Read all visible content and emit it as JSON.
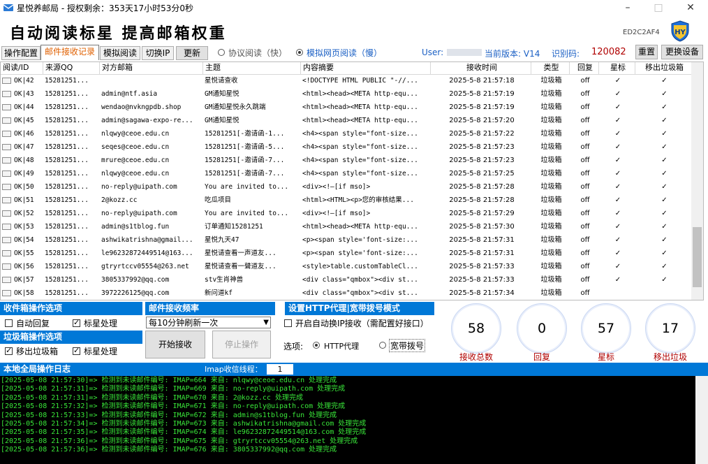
{
  "window": {
    "title": "星悦养邮局 - 授权剩余：353天17小时53分0秒",
    "min_icon": "minimize-icon",
    "max_icon": "maximize-icon",
    "close_icon": "close-icon"
  },
  "header": {
    "title": "自动阅读标星 提高邮箱权重",
    "code": "ED2C2AF4",
    "logo_icon": "app-logo-icon"
  },
  "tabs": [
    {
      "label": "操作配置"
    },
    {
      "label": "邮件接收记录"
    },
    {
      "label": "模拟阅读"
    },
    {
      "label": "切换IP"
    }
  ],
  "toolbar": {
    "update_label": "更新",
    "radio_protocol": "协议阅读（快）",
    "radio_web": "模拟网页阅读（慢）",
    "user_label": "User:",
    "version_label": "当前版本: V14",
    "id_label": "识别码:",
    "id_value": "120082",
    "reset_label": "重置",
    "switch_device_label": "更换设备"
  },
  "table": {
    "columns": [
      "阅读/ID",
      "来源QQ",
      "对方邮箱",
      "主题",
      "内容摘要",
      "接收时间",
      "类型",
      "回复",
      "星标",
      "移出垃圾箱"
    ],
    "rows": [
      [
        "OK|42",
        "15281251...",
        "",
        "星悦请查收",
        "<!DOCTYPE HTML PUBLIC \"-//...",
        "2025-5-8 21:57:18",
        "垃圾箱",
        "off",
        "✓",
        "✓"
      ],
      [
        "OK|43",
        "15281251...",
        "admin@ntf.asia",
        "GM通知星悦",
        "<html><head><META http-equ...",
        "2025-5-8 21:57:19",
        "垃圾箱",
        "off",
        "✓",
        "✓"
      ],
      [
        "OK|44",
        "15281251...",
        "wendao@nvkngpdb.shop",
        "GM通知星悦永久跳端",
        "<html><head><META http-equ...",
        "2025-5-8 21:57:19",
        "垃圾箱",
        "off",
        "✓",
        "✓"
      ],
      [
        "OK|45",
        "15281251...",
        "admin@sagawa-expo-re...",
        "GM通知星悦",
        "<html><head><META http-equ...",
        "2025-5-8 21:57:20",
        "垃圾箱",
        "off",
        "✓",
        "✓"
      ],
      [
        "OK|46",
        "15281251...",
        "nlqwy@ceoe.edu.cn",
        "15281251[-邀请函-1...",
        "<h4><span style=\"font-size...",
        "2025-5-8 21:57:22",
        "垃圾箱",
        "off",
        "✓",
        "✓"
      ],
      [
        "OK|47",
        "15281251...",
        "seqes@ceoe.edu.cn",
        "15281251[-邀请函-5...",
        "<h4><span style=\"font-size...",
        "2025-5-8 21:57:23",
        "垃圾箱",
        "off",
        "✓",
        "✓"
      ],
      [
        "OK|48",
        "15281251...",
        "mrure@ceoe.edu.cn",
        "15281251[-邀请函-7...",
        "<h4><span style=\"font-size...",
        "2025-5-8 21:57:23",
        "垃圾箱",
        "off",
        "✓",
        "✓"
      ],
      [
        "OK|49",
        "15281251...",
        "nlqwy@ceoe.edu.cn",
        "15281251[-邀请函-7...",
        "<h4><span style=\"font-size...",
        "2025-5-8 21:57:25",
        "垃圾箱",
        "off",
        "✓",
        "✓"
      ],
      [
        "OK|50",
        "15281251...",
        "no-reply@uipath.com",
        "You are invited to...",
        "<div><!—[if mso]>",
        "2025-5-8 21:57:28",
        "垃圾箱",
        "off",
        "✓",
        "✓"
      ],
      [
        "OK|51",
        "15281251...",
        "2@kozz.cc",
        "吃瓜项目",
        "<html><HTML><p>您的审核结果...",
        "2025-5-8 21:57:28",
        "垃圾箱",
        "off",
        "✓",
        "✓"
      ],
      [
        "OK|52",
        "15281251...",
        "no-reply@uipath.com",
        "You are invited to...",
        "<div><!—[if mso]>",
        "2025-5-8 21:57:29",
        "垃圾箱",
        "off",
        "✓",
        "✓"
      ],
      [
        "OK|53",
        "15281251...",
        "admin@s1tblog.fun",
        "订单通知15281251",
        "<html><head><META http-equ...",
        "2025-5-8 21:57:30",
        "垃圾箱",
        "off",
        "✓",
        "✓"
      ],
      [
        "OK|54",
        "15281251...",
        "ashwikatrishna@gmail...",
        "星悦九天47",
        "<p><span style='font-size:...",
        "2025-5-8 21:57:31",
        "垃圾箱",
        "off",
        "✓",
        "✓"
      ],
      [
        "OK|55",
        "15281251...",
        "le96232872449514@163...",
        "星悦请查看一声道友...",
        "<p><span style='font-size:...",
        "2025-5-8 21:57:31",
        "垃圾箱",
        "off",
        "✓",
        "✓"
      ],
      [
        "OK|56",
        "15281251...",
        "gtryrtccv05554@263.net",
        "星悦请查看一聲道友...",
        "<style>table.customTableCl...",
        "2025-5-8 21:57:33",
        "垃圾箱",
        "off",
        "✓",
        "✓"
      ],
      [
        "OK|57",
        "15281251...",
        "3805337992@qq.com",
        "stv生肖神兽",
        "<div class=\"qmbox\"><div st...",
        "2025-5-8 21:57:33",
        "垃圾箱",
        "off",
        "✓",
        "✓"
      ],
      [
        "OK|58",
        "15281251...",
        "3972226125@qq.com",
        "新问道kf",
        "<div class=\"qmbox\"><div st...",
        "2025-5-8 21:57:34",
        "垃圾箱",
        "off",
        "",
        ""
      ]
    ]
  },
  "panels": {
    "inbox_header": "收件箱操作选项",
    "auto_reply": "自动回复",
    "star_handle": "标星处理",
    "junk_header": "垃圾箱操作选项",
    "move_out_junk": "移出垃圾箱",
    "junk_star_handle": "标星处理",
    "freq_header": "邮件接收频率",
    "freq_value": "每10分钟刷新一次",
    "start_label": "开始接收",
    "stop_label": "停止操作",
    "proxy_header": "设置HTTP代理|宽带拨号模式",
    "auto_ip": "开启自动换IP接收（需配置好接口）",
    "option_label": "选项:",
    "http_proxy": "HTTP代理",
    "broadband": "宽带拨号"
  },
  "stats": [
    {
      "value": "58",
      "label": "接收总数"
    },
    {
      "value": "0",
      "label": "回复"
    },
    {
      "value": "57",
      "label": "星标"
    },
    {
      "value": "17",
      "label": "移出垃圾"
    }
  ],
  "log": {
    "header": "本地全局操作日志",
    "threads_label": "Imap收信线程：",
    "threads_value": "1",
    "lines": [
      "[2025-05-08 21:57:30]=> 检测到未读邮件编号: IMAP=664 来自: nlqwy@ceoe.edu.cn 处理完成",
      "[2025-05-08 21:57:31]=> 检测到未读邮件编号: IMAP=669 来自: no-reply@uipath.com 处理完成",
      "[2025-05-08 21:57:31]=> 检测到未读邮件编号: IMAP=670 来自: 2@kozz.cc 处理完成",
      "[2025-05-08 21:57:32]=> 检测到未读邮件编号: IMAP=671 来自: no-reply@uipath.com 处理完成",
      "[2025-05-08 21:57:33]=> 检测到未读邮件编号: IMAP=672 来自: admin@s1tblog.fun 处理完成",
      "[2025-05-08 21:57:34]=> 检测到未读邮件编号: IMAP=673 来自: ashwikatrishna@gmail.com 处理完成",
      "[2025-05-08 21:57:35]=> 检测到未读邮件编号: IMAP=674 来自: le96232872449514@163.com 处理完成",
      "[2025-05-08 21:57:36]=> 检测到未读邮件编号: IMAP=675 来自: gtryrtccv05554@263.net 处理完成",
      "[2025-05-08 21:57:36]=> 检测到未读邮件编号: IMAP=676 来自: 3805337992@qq.com 处理完成"
    ]
  },
  "colors": {
    "accent": "#0078d7",
    "log_text": "#39e639",
    "stat_label": "#b00000",
    "id_value": "#b00000",
    "version": "#1a5fc4"
  }
}
